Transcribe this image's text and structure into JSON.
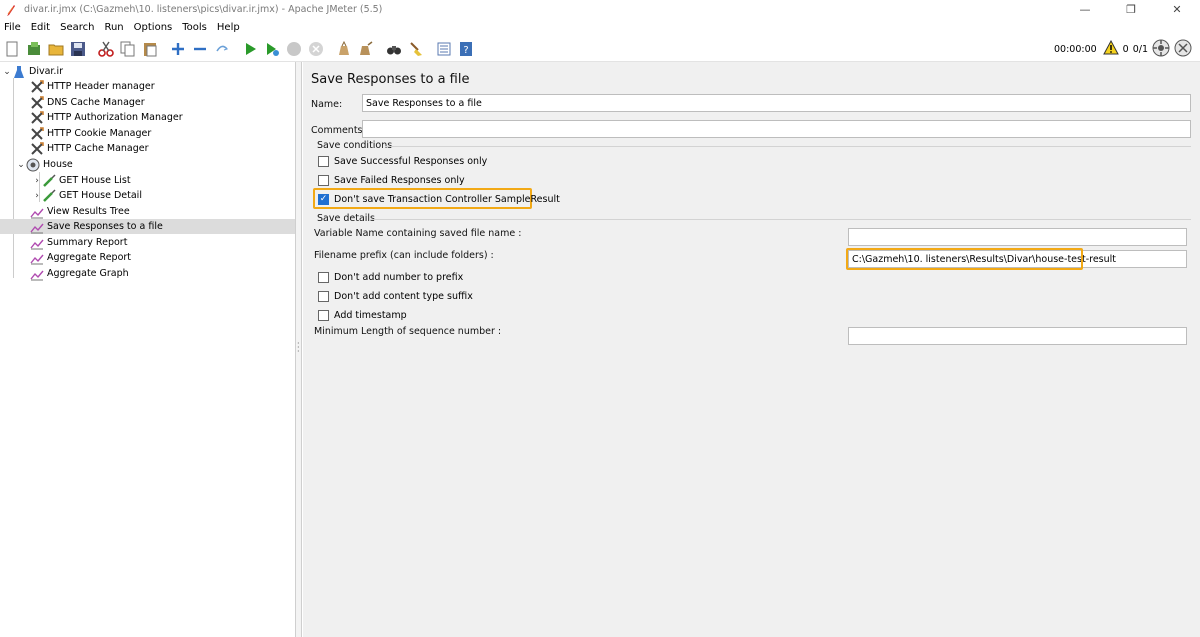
{
  "window": {
    "title": "divar.ir.jmx (C:\\Gazmeh\\10. listeners\\pics\\divar.ir.jmx) - Apache JMeter (5.5)",
    "minimize": "—",
    "restore": "❐",
    "close": "✕"
  },
  "menu": {
    "items": [
      "File",
      "Edit",
      "Search",
      "Run",
      "Options",
      "Tools",
      "Help"
    ]
  },
  "toolbar": {
    "timer": "00:00:00",
    "warnings": "0",
    "threads": "0/1"
  },
  "tree": {
    "root": "Divar.ir",
    "items": [
      "HTTP Header manager",
      "DNS Cache Manager",
      "HTTP Authorization Manager",
      "HTTP Cookie Manager",
      "HTTP Cache Manager",
      "House",
      "GET House List",
      "GET House Detail",
      "View Results Tree",
      "Save Responses to a file",
      "Summary Report",
      "Aggregate Report",
      "Aggregate Graph"
    ]
  },
  "panel": {
    "heading": "Save Responses to a file",
    "name_label": "Name:",
    "name_value": "Save Responses to a file",
    "comments_label": "Comments:",
    "comments_value": "",
    "save_conditions": {
      "legend": "Save conditions",
      "successful_only": "Save Successful Responses only",
      "failed_only": "Save Failed Responses only",
      "dont_save_tc": "Don't save Transaction Controller SampleResult"
    },
    "save_details": {
      "legend": "Save details",
      "variable_name_label": "Variable Name containing saved file name :",
      "variable_name_value": "",
      "prefix_label": "Filename prefix (can include folders) :",
      "prefix_value": "C:\\Gazmeh\\10. listeners\\Results\\Divar\\house-test-result",
      "dont_add_number": "Don't add number to prefix",
      "dont_add_suffix": "Don't add content type suffix",
      "add_timestamp": "Add timestamp",
      "min_length_label": "Minimum Length of sequence number :",
      "min_length_value": ""
    }
  },
  "colors": {
    "highlight": "#f2a916",
    "checkbox_checked": "#1f6fd1",
    "selected_row": "#dcdcdc"
  }
}
